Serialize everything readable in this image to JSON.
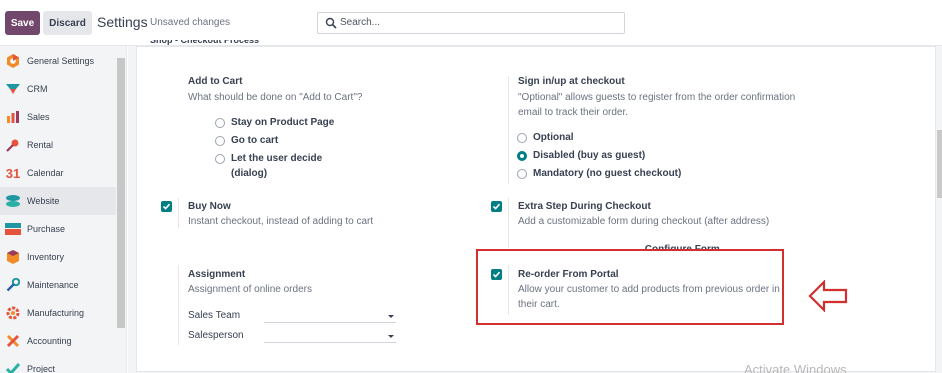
{
  "toolbar": {
    "save_label": "Save",
    "discard_label": "Discard",
    "title": "Settings",
    "unsaved": "Unsaved changes"
  },
  "search": {
    "placeholder": "Search..."
  },
  "sidebar": {
    "items": [
      {
        "label": "General Settings",
        "icon": "general-settings-icon"
      },
      {
        "label": "CRM",
        "icon": "crm-icon"
      },
      {
        "label": "Sales",
        "icon": "sales-icon"
      },
      {
        "label": "Rental",
        "icon": "rental-icon"
      },
      {
        "label": "Calendar",
        "icon": "calendar-icon",
        "icon_text": "31"
      },
      {
        "label": "Website",
        "icon": "website-icon",
        "active": true
      },
      {
        "label": "Purchase",
        "icon": "purchase-icon"
      },
      {
        "label": "Inventory",
        "icon": "inventory-icon"
      },
      {
        "label": "Maintenance",
        "icon": "maintenance-icon"
      },
      {
        "label": "Manufacturing",
        "icon": "manufacturing-icon"
      },
      {
        "label": "Accounting",
        "icon": "accounting-icon"
      },
      {
        "label": "Project",
        "icon": "project-icon"
      }
    ]
  },
  "section": {
    "title": "Shop - Checkout Process"
  },
  "settings": {
    "add_to_cart": {
      "label": "Add to Cart",
      "desc": "What should be done on \"Add to Cart\"?",
      "options": [
        "Stay on Product Page",
        "Go to cart",
        "Let the user decide",
        "(dialog)"
      ]
    },
    "signin": {
      "label": "Sign in/up at checkout",
      "desc1": "\"Optional\" allows guests to register from the order confirmation",
      "desc2": "email to track their order.",
      "options": [
        "Optional",
        "Disabled (buy as guest)",
        "Mandatory (no guest checkout)"
      ],
      "selected": "Disabled (buy as guest)"
    },
    "buy_now": {
      "label": "Buy Now",
      "desc": "Instant checkout, instead of adding to cart",
      "checked": true
    },
    "extra_step": {
      "label": "Extra Step During Checkout",
      "desc": "Add a customizable form during checkout (after address)",
      "checked": true,
      "link": "→ Configure Form"
    },
    "assignment": {
      "label": "Assignment",
      "desc": "Assignment of online orders",
      "fields": [
        "Sales Team",
        "Salesperson"
      ]
    },
    "reorder": {
      "label": "Re-order From Portal",
      "desc1": "Allow your customer to add products from previous order in",
      "desc2": "their cart.",
      "checked": true
    }
  },
  "overlay": {
    "watermark": "Activate Windows",
    "highlight_color": "#d32f2f"
  },
  "colors": {
    "brand": "#71486b",
    "accent": "#017e84"
  }
}
